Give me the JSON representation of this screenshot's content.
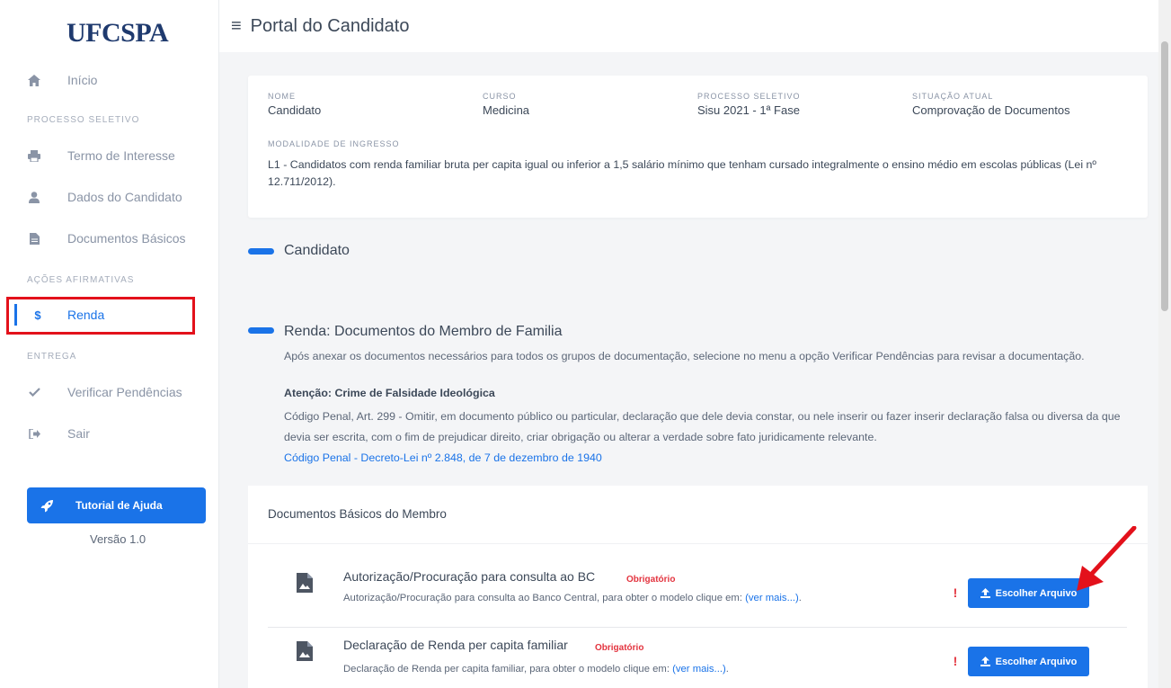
{
  "brand": {
    "logo": "UFCSPA"
  },
  "header": {
    "title": "Portal do Candidato",
    "menu_icon": "hamburger-icon"
  },
  "sidebar": {
    "inicio": {
      "label": "Início",
      "icon": "home-icon"
    },
    "section_processo": "PROCESSO SELETIVO",
    "termo": {
      "label": "Termo de Interesse",
      "icon": "printer-icon"
    },
    "dados": {
      "label": "Dados do Candidato",
      "icon": "user-icon"
    },
    "docs": {
      "label": "Documentos Básicos",
      "icon": "file-icon"
    },
    "section_acoes": "AÇÕES AFIRMATIVAS",
    "renda": {
      "label": "Renda",
      "icon": "dollar-icon"
    },
    "section_entrega": "ENTREGA",
    "verificar": {
      "label": "Verificar Pendências",
      "icon": "check-icon"
    },
    "sair": {
      "label": "Sair",
      "icon": "sign-out-icon"
    },
    "help_button": "Tutorial de Ajuda",
    "version": "Versão 1.0"
  },
  "info": {
    "nome_label": "NOME",
    "nome": "Candidato",
    "curso_label": "CURSO",
    "curso": "Medicina",
    "processo_label": "PROCESSO SELETIVO",
    "processo": "Sisu 2021 - 1ª Fase",
    "situacao_label": "SITUAÇÃO ATUAL",
    "situacao": "Comprovação de Documentos",
    "modalidade_label": "MODALIDADE DE INGRESSO",
    "modalidade": "L1 - Candidatos com renda familiar bruta per capita igual ou inferior a 1,5 salário mínimo que tenham cursado integralmente o ensino médio em escolas públicas (Lei nº 12.711/2012)."
  },
  "sections": {
    "candidato": "Candidato",
    "renda_title": "Renda: Documentos do Membro de Familia",
    "renda_desc": "Após anexar os documentos necessários para todos os grupos de documentação, selecione no menu a opção Verificar Pendências para revisar a documentação.",
    "atencao": "Atenção: Crime de Falsidade Ideológica",
    "penal_text": "Código Penal, Art. 299 - Omitir, em documento público ou particular, declaração que dele devia constar, ou nele inserir ou fazer inserir declaração falsa ou diversa da que devia ser escrita, com o fim de prejudicar direito, criar obrigação ou alterar a verdade sobre fato juridicamente relevante.",
    "penal_link": "Código Penal - Decreto-Lei nº 2.848, de 7 de dezembro de 1940"
  },
  "documents": {
    "header": "Documentos Básicos do Membro",
    "items": [
      {
        "title": "Autorização/Procuração para consulta ao BC",
        "badge": "Obrigatório",
        "desc": "Autorização/Procuração para consulta ao Banco Central, para obter o modelo clique em: ",
        "more": "(ver mais...)",
        "after": ".",
        "warn": "!",
        "button": "Escolher Arquivo"
      },
      {
        "title": "Declaração de Renda per capita familiar",
        "badge": "Obrigatório",
        "desc": "Declaração de Renda per capita familiar, para obter o modelo clique em: ",
        "more": "(ver mais...)",
        "after": ".",
        "warn": "!",
        "button": "Escolher Arquivo"
      }
    ]
  },
  "colors": {
    "accent": "#1a73e8",
    "required": "#e3343f",
    "annotation": "#e3111b"
  }
}
